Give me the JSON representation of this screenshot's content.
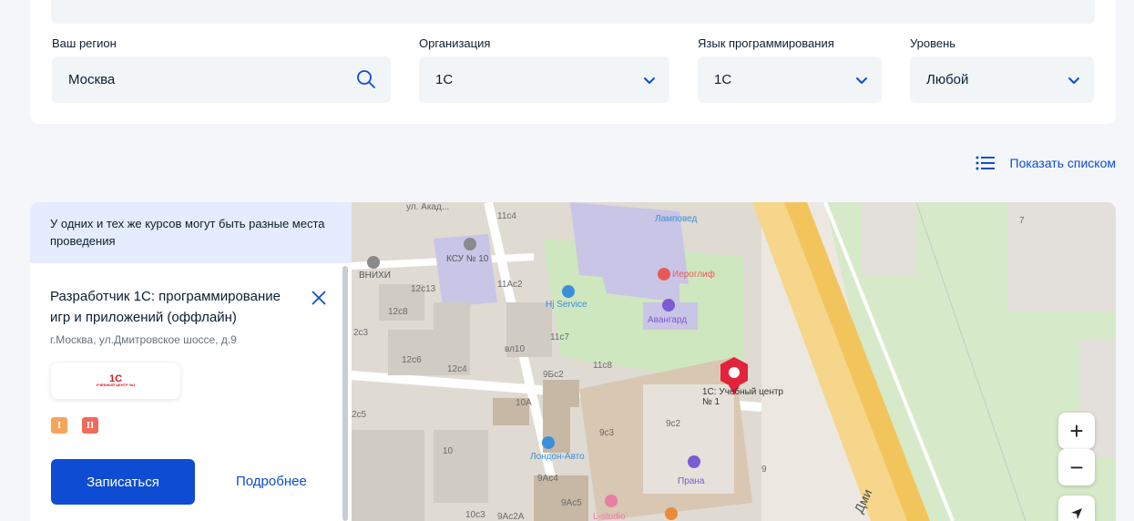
{
  "filters": {
    "region": {
      "label": "Ваш регион",
      "value": "Москва"
    },
    "organization": {
      "label": "Организация",
      "value": "1С"
    },
    "language": {
      "label": "Язык программирования",
      "value": "1С"
    },
    "level": {
      "label": "Уровень",
      "value": "Любой"
    }
  },
  "show_list": "Показать списком",
  "panel": {
    "notice": "У одних и тех же курсов могут быть разные места проведения",
    "course_title": "Разработчик 1С: программирование игр и приложений (оффлайн)",
    "address": "г.Москва, ул.Дмитровское шоссе, д.9",
    "logo": {
      "main": "1С",
      "sub": "УЧЕБНЫЙ ЦЕНТР №1"
    },
    "badges": [
      "I",
      "II"
    ],
    "enroll_button": "Записаться",
    "more_link": "Подробнее"
  },
  "map": {
    "labels": {
      "street1": "ул. Акад...",
      "b11c4": "11с4",
      "lampoved": "Ламповед",
      "ksu": "КСУ № 10",
      "vnihi": "ВНИХИ",
      "b12c13": "12с13",
      "b11ac2": "11Ас2",
      "ieroglif": "Иероглиф",
      "b12c8": "12с8",
      "hj": "Hj Service",
      "avangard": "Авангард",
      "b2c3": "2с3",
      "b11c7": "11с7",
      "vl10": "вл10",
      "b12c6": "12с6",
      "b12c4": "12с4",
      "b9bc2": "9Бс2",
      "b11c8": "11с8",
      "center_name": "1С: Учебный центр № 1",
      "b10a": "10А",
      "b2c5": "2с5",
      "b9c3": "9с3",
      "b9c2": "9с2",
      "b10": "10",
      "london": "Лондон-Авто",
      "prana": "Прана",
      "b9ac4": "9Ас4",
      "b9": "9",
      "b9ac5": "9Ас5",
      "b10c3": "10с3",
      "b9ac2a": "9Ас2А",
      "lstudio": "L-studio",
      "b7": "7",
      "road": "Дми"
    },
    "zoom_in": "+",
    "zoom_out": "−"
  },
  "colors": {
    "accent": "#0d4cd3",
    "badge1": "#f8a55b",
    "badge2": "#f16a5a"
  }
}
